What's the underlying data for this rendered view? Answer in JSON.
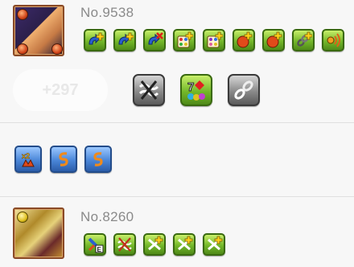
{
  "monsters": [
    {
      "id_label": "No.9538"
    },
    {
      "id_label": "No.8260"
    }
  ],
  "plus_label": "+297",
  "colors": {
    "background": "#f7f7f7",
    "awakening_green": "#74b82a",
    "awakening_gray": "#8a8a8a",
    "awakening_blue": "#4a86d8",
    "divider": "#e0e0e0"
  },
  "icons": {
    "row1": [
      "skill-boost-plus-icon",
      "skill-boost-plus-icon",
      "skill-boost-minus-icon",
      "orb-enhance-rainbow-icon",
      "orb-enhance-rainbow-icon",
      "enhanced-orb-plus-icon",
      "enhanced-orb-plus-icon",
      "bind-resist-plus-icon",
      "voice-awakening-icon"
    ],
    "row2": [
      "cloud-resist-icon",
      "seven-colors-icon",
      "bind-chain-icon"
    ],
    "row3": [
      "skill-boost-bound-icon",
      "super-skill-icon",
      "super-skill-icon"
    ],
    "row4": [
      "evo-e-awakening-icon",
      "cloud-resist-icon",
      "sb-resist-plus-icon",
      "sb-resist-plus-icon",
      "sb-resist-plus-icon"
    ]
  }
}
